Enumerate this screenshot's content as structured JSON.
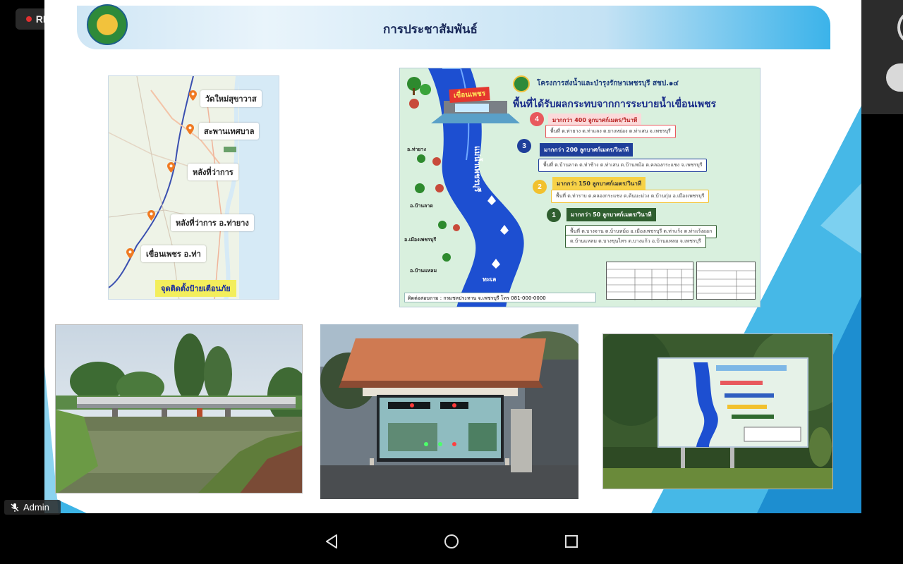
{
  "recording": {
    "label": "REC",
    "dot_color": "#e03030"
  },
  "slide": {
    "title": "การประชาสัมพันธ์",
    "map": {
      "places": [
        "วัดใหม่สุขาวาส",
        "สะพานเทศบาล",
        "หลังที่ว่าการ",
        "หลังที่ว่าการ  อ.ท่ายาง",
        "เขื่อนเพชร อ.ท่า"
      ],
      "warning_label": "จุดติดตั้งป้ายเตือนภัย"
    },
    "poster": {
      "heading_1": "โครงการส่งน้ำและบำรุงรักษาเพชรบุรี สชป.๑๔",
      "heading_2": "พื้นที่ได้รับผลกระทบจากการระบายน้ำเขื่อนเพชร",
      "dam_label": "เขื่อนเพชร",
      "river_label": "แม่น้ำเพชรบุรี",
      "river_end_label": "ทะเล",
      "zones": [
        {
          "num": "4",
          "rate": "มากกว่า 400 ลูกบาศก์เมตร/วินาที",
          "area": "พื้นที่ ต.ท่ายาง ต.ท่าแลง ต.ยางหย่อง ต.ท่าเสน จ.เพชรบุรี",
          "color": "#e8595d"
        },
        {
          "num": "3",
          "rate": "มากกว่า 200 ลูกบาศก์เมตร/วินาที",
          "area": "พื้นที่ ต.บ้านลาด ต.ท่าช้าง ต.ท่าเสน ต.บ้านหม้อ ต.คลองกระแชง จ.เพชรบุรี",
          "color": "#1f3f9a"
        },
        {
          "num": "2",
          "rate": "มากกว่า 150 ลูกบาศก์เมตร/วินาที",
          "area": "พื้นที่ ต.ท่าราบ ต.คลองกระแชง ต.ต้นมะม่วง ต.บ้านกุ่ม อ.เมืองเพชรบุรี",
          "color": "#f2c12e"
        },
        {
          "num": "1",
          "rate": "มากกว่า 50 ลูกบาศก์เมตร/วินาที",
          "area": "พื้นที่ ต.บางจาน ต.บ้านหม้อ อ.เมืองเพชรบุรี ต.ท่าแร้ง ต.ท่าแร้งออก",
          "area_2": "ต.บ้านแหลม ต.บางขุนไทร ต.บางแก้ว อ.บ้านแหลม จ.เพชรบุรี",
          "color": "#2f5e2f"
        }
      ],
      "side_labels": [
        "อ.ท่ายาง",
        "อ.บ้านลาด",
        "อ.เมืองเพชรบุรี",
        "อ.บ้านแหลม"
      ],
      "contact": "ติดต่อสอบถาม : กรมชลประทาน จ.เพชรบุรี โทร 081-000-0000"
    }
  },
  "participant": {
    "name": "Admin"
  },
  "nav": {
    "back": "back",
    "home": "home",
    "recents": "recents"
  },
  "colors": {
    "accent": "#3cb4e6",
    "header_text": "#1a2a5a"
  }
}
